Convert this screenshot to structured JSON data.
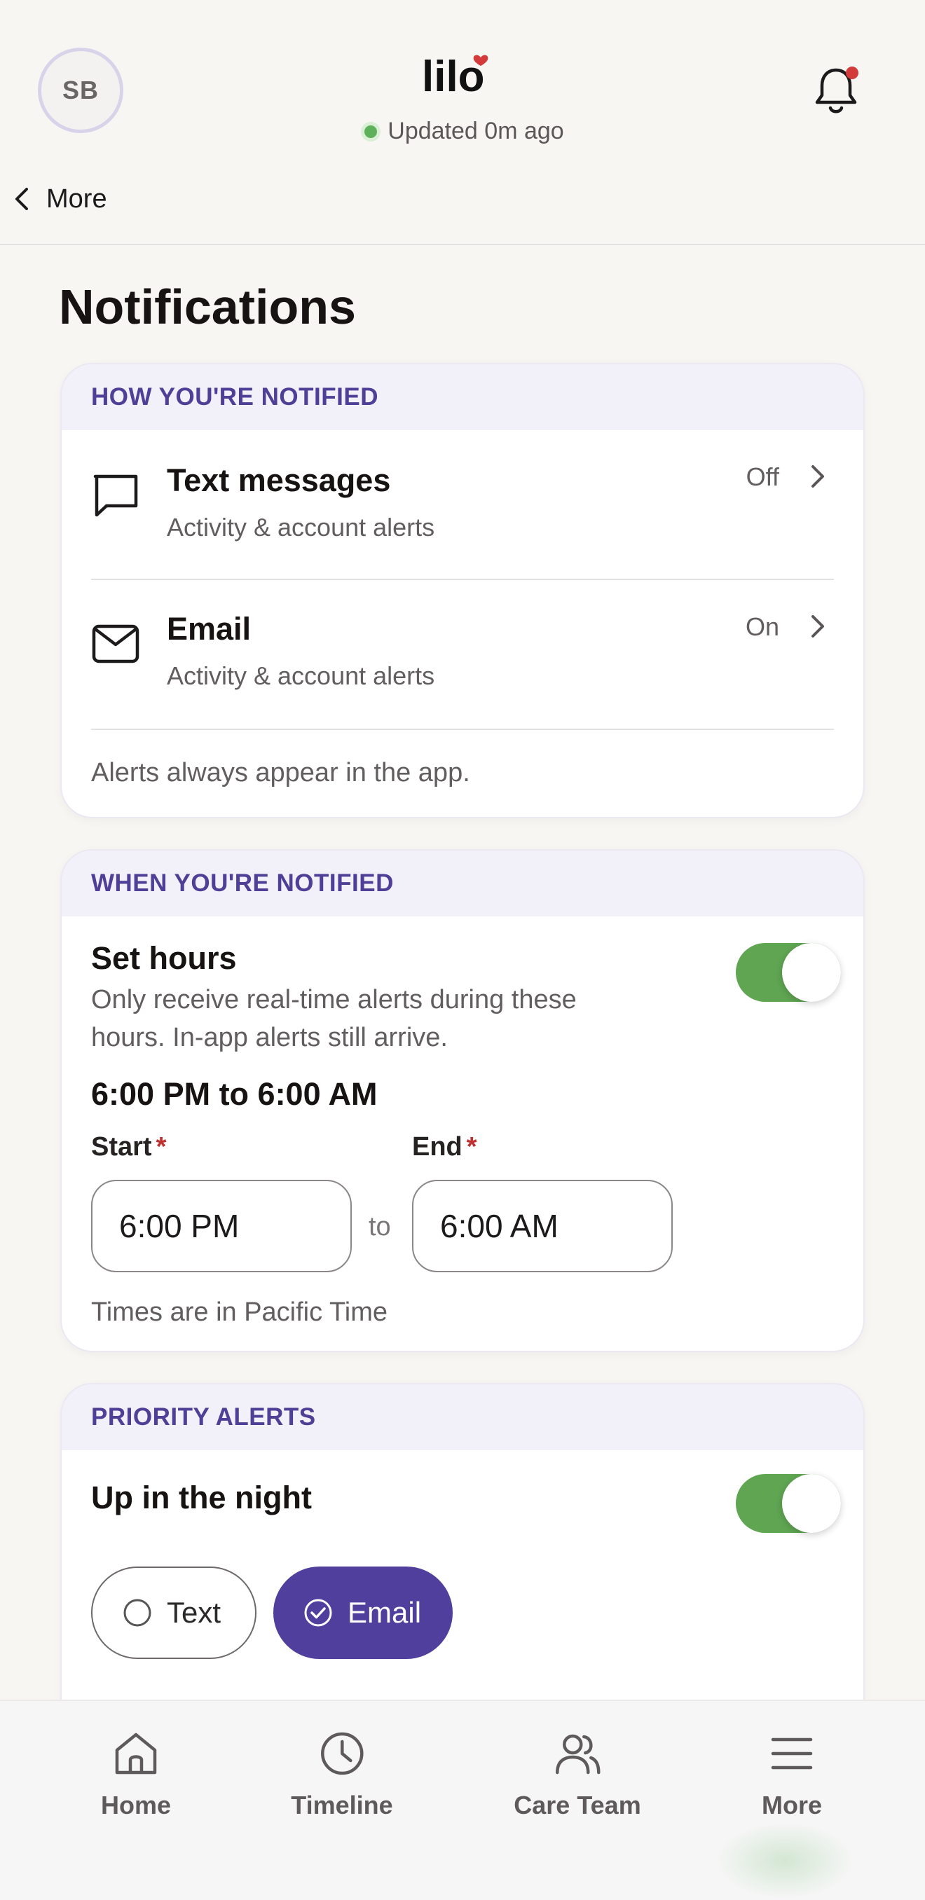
{
  "header": {
    "avatar_initials": "SB",
    "logo_text": "lilo",
    "status_text": "Updated 0m ago",
    "back_label": "More"
  },
  "page": {
    "title": "Notifications"
  },
  "how_notified": {
    "heading": "HOW YOU'RE NOTIFIED",
    "items": [
      {
        "icon": "chat-bubble-icon",
        "title": "Text messages",
        "subtitle": "Activity & account alerts",
        "state": "Off"
      },
      {
        "icon": "mail-icon",
        "title": "Email",
        "subtitle": "Activity & account alerts",
        "state": "On"
      }
    ],
    "footnote": "Alerts always appear in the app."
  },
  "when_notified": {
    "heading": "WHEN YOU'RE NOTIFIED",
    "set_hours_title": "Set hours",
    "set_hours_desc_line1": "Only receive real-time alerts during these",
    "set_hours_desc_line2": "hours. In-app alerts still arrive.",
    "set_hours_enabled": true,
    "range_summary": "6:00 PM to 6:00 AM",
    "start_label": "Start",
    "end_label": "End",
    "required_mark": "*",
    "start_value": "6:00 PM",
    "end_value": "6:00 AM",
    "separator": "to",
    "timezone_note": "Times are in Pacific Time"
  },
  "priority_alerts": {
    "heading": "PRIORITY ALERTS",
    "item_title": "Up in the night",
    "enabled": true,
    "options": [
      {
        "label": "Text",
        "selected": false
      },
      {
        "label": "Email",
        "selected": true
      }
    ]
  },
  "bottom_nav": [
    {
      "label": "Home",
      "icon": "home-icon"
    },
    {
      "label": "Timeline",
      "icon": "clock-icon"
    },
    {
      "label": "Care Team",
      "icon": "people-icon"
    },
    {
      "label": "More",
      "icon": "menu-icon"
    }
  ],
  "colors": {
    "accent_purple": "#503f9c",
    "section_heading": "#4f3f96",
    "toggle_on": "#5fa552",
    "status_dot": "#5fb05a",
    "required": "#c0302f",
    "notification_dot": "#d33a3a"
  }
}
